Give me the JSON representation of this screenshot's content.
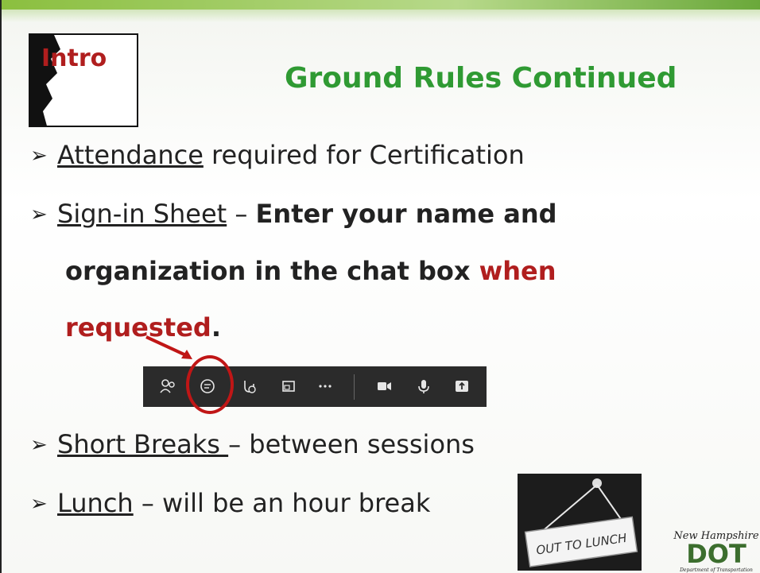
{
  "badge": {
    "label": "Intro"
  },
  "title": "Ground Rules Continued",
  "bullets": {
    "b1": {
      "underlined": "Attendance",
      "rest": " required for Certification"
    },
    "b2": {
      "underlined": "Sign-in Sheet",
      "dash": " – ",
      "bold1": "Enter your name and",
      "bold2": "organization in the chat box ",
      "red1": "when",
      "red2": "requested",
      "period": "."
    },
    "b3": {
      "underlined": "Short Breaks ",
      "rest": "– between sessions"
    },
    "b4": {
      "underlined": "Lunch",
      "rest": " – will be an hour break"
    }
  },
  "toolbar_icons": [
    "people-icon",
    "chat-icon",
    "reactions-icon",
    "view-icon",
    "more-icon",
    "camera-icon",
    "mic-icon",
    "share-icon"
  ],
  "lunch_sign": {
    "text": "OUT TO LUNCH"
  },
  "logo": {
    "line1": "New Hampshire",
    "line2": "DOT",
    "line3": "Department of Transportation"
  },
  "colors": {
    "title": "#2f9a33",
    "accent_red": "#b01e1e",
    "toolbar": "#2b2b2b"
  }
}
